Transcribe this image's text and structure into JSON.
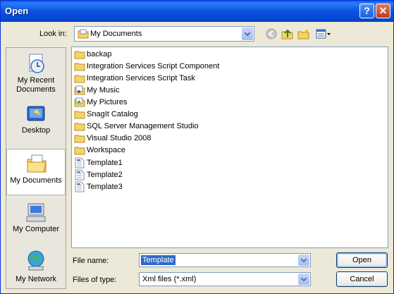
{
  "title": "Open",
  "title_buttons": {
    "help": "?",
    "close": "✕"
  },
  "look_in": {
    "label": "Look in:",
    "value": "My Documents"
  },
  "toolbar": [
    "back-icon",
    "up-folder-icon",
    "new-folder-icon",
    "views-menu-icon"
  ],
  "places": [
    {
      "label": "My Recent Documents",
      "icon": "recent-documents-icon"
    },
    {
      "label": "Desktop",
      "icon": "desktop-icon"
    },
    {
      "label": "My Documents",
      "icon": "my-documents-icon",
      "selected": true
    },
    {
      "label": "My Computer",
      "icon": "my-computer-icon"
    },
    {
      "label": "My Network",
      "icon": "my-network-icon"
    }
  ],
  "files": [
    {
      "name": "backap",
      "type": "folder"
    },
    {
      "name": "Integration Services Script Component",
      "type": "folder"
    },
    {
      "name": "Integration Services Script Task",
      "type": "folder"
    },
    {
      "name": "My Music",
      "type": "music-folder"
    },
    {
      "name": "My Pictures",
      "type": "pictures-folder"
    },
    {
      "name": "SnagIt Catalog",
      "type": "folder"
    },
    {
      "name": "SQL Server Management Studio",
      "type": "folder"
    },
    {
      "name": "Visual Studio 2008",
      "type": "folder"
    },
    {
      "name": "Workspace",
      "type": "folder"
    },
    {
      "name": "Template1",
      "type": "xml-file"
    },
    {
      "name": "Template2",
      "type": "xml-file"
    },
    {
      "name": "Template3",
      "type": "xml-file"
    }
  ],
  "file_name": {
    "label": "File name:",
    "value": "Template"
  },
  "file_type": {
    "label": "Files of type:",
    "value": "Xml files (*.xml)"
  },
  "buttons": {
    "open": "Open",
    "cancel": "Cancel"
  },
  "colors": {
    "title_bar": "#0a53e0",
    "selection": "#316ac5",
    "dialog_bg": "#ece9d8"
  }
}
